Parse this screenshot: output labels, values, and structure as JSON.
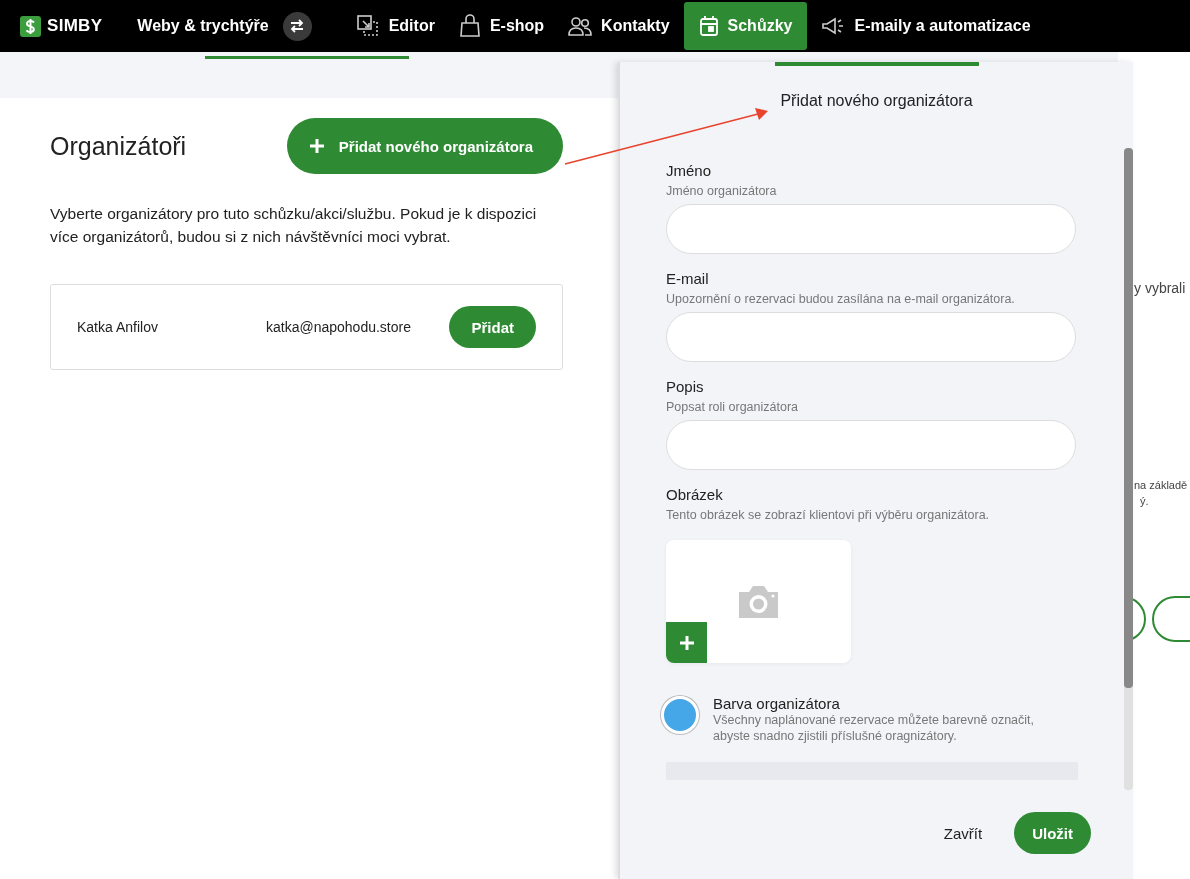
{
  "nav": {
    "logo": "SIMBY",
    "sites": "Weby & trychtýře",
    "items": [
      {
        "label": "Editor",
        "selected": false
      },
      {
        "label": "E-shop",
        "selected": false
      },
      {
        "label": "Kontakty",
        "selected": false
      },
      {
        "label": "Schůzky",
        "selected": true
      },
      {
        "label": "E-maily a automatizace",
        "selected": false
      }
    ]
  },
  "organizers": {
    "title": "Organizátoři",
    "add_button": "Přidat nového organizátora",
    "description": "Vyberte organizátory pro tuto schůzku/akci/službu. Pokud je k dispozici více organizátorů, budou si z nich návštěvníci moci vybrat.",
    "rows": [
      {
        "name": "Katka Anfilov",
        "email": "katka@napohodu.store",
        "button": "Přidat"
      }
    ]
  },
  "background_texts": [
    "y vybrali",
    "na základě",
    "ý."
  ],
  "modal": {
    "title": "Přidat nového organizátora",
    "fields": [
      {
        "label": "Jméno",
        "hint": "Jméno organizátora"
      },
      {
        "label": "E-mail",
        "hint": "Upozornění o rezervaci budou zasílána na e-mail organizátora."
      },
      {
        "label": "Popis",
        "hint": "Popsat roli organizátora"
      }
    ],
    "image": {
      "label": "Obrázek",
      "hint": "Tento obrázek se zobrazí klientovi při výběru organizátora."
    },
    "color": {
      "label": "Barva organizátora",
      "text": "Všechny naplánované rezervace můžete barevně označit, abyste snadno zjistili příslušné oragnizátory.",
      "color": "#45a6e8"
    },
    "buttons": {
      "close": "Zavřít",
      "save": "Uložit"
    }
  }
}
